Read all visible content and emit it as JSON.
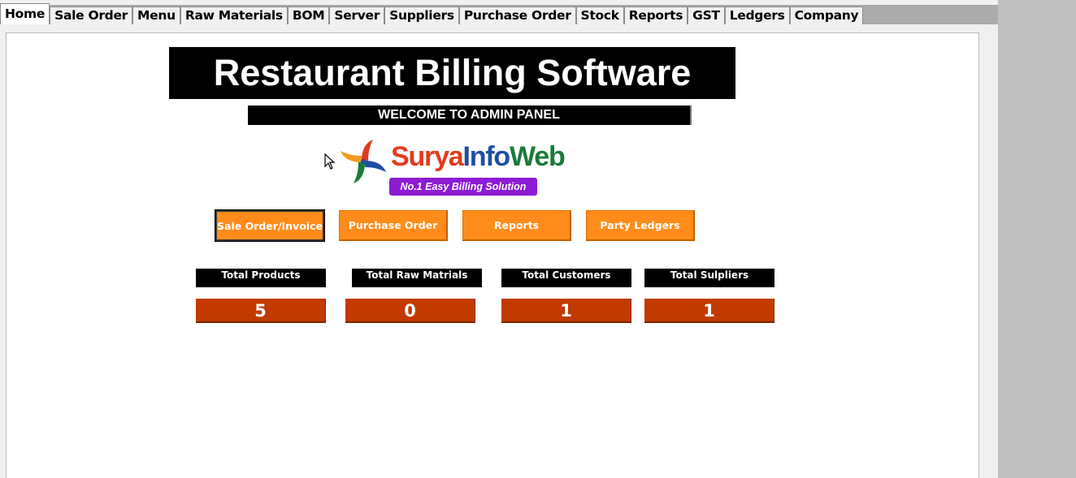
{
  "tabs": [
    {
      "label": "Home",
      "active": true
    },
    {
      "label": "Sale Order"
    },
    {
      "label": "Menu"
    },
    {
      "label": "Raw Materials"
    },
    {
      "label": "BOM"
    },
    {
      "label": "Server"
    },
    {
      "label": "Suppliers"
    },
    {
      "label": "Purchase Order"
    },
    {
      "label": "Stock"
    },
    {
      "label": "Reports"
    },
    {
      "label": "GST"
    },
    {
      "label": "Ledgers"
    },
    {
      "label": "Company"
    }
  ],
  "header": {
    "title": "Restaurant Billing Software",
    "welcome": "WELCOME TO  ADMIN PANEL"
  },
  "logo": {
    "name_part1": "Surya",
    "name_part2": "Info",
    "name_part3": "Web",
    "tagline": "No.1 Easy Billing Solution"
  },
  "actions": {
    "sale_order": "Sale Order/Invoice",
    "purchase_order": "Purchase Order",
    "reports": "Reports",
    "party_ledgers": "Party Ledgers"
  },
  "stats": [
    {
      "label": "Total Products",
      "value": "5"
    },
    {
      "label": "Total Raw Matrials",
      "value": "0"
    },
    {
      "label": "Total Customers",
      "value": "1"
    },
    {
      "label": "Total Sulpliers",
      "value": "1"
    }
  ],
  "colors": {
    "button_orange": "#ff8c1a",
    "stat_value_bg": "#c23a00",
    "tagline_bg": "#8d1bd4"
  }
}
